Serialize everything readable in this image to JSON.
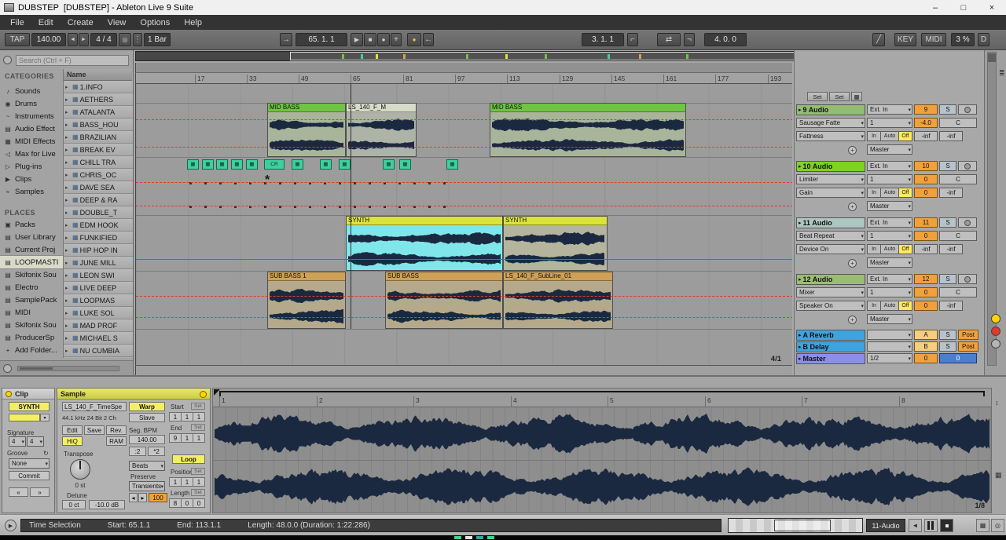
{
  "window": {
    "title": "DUBSTEP  [DUBSTEP] - Ableton Live 9 Suite"
  },
  "menu": {
    "items": [
      "File",
      "Edit",
      "Create",
      "View",
      "Options",
      "Help"
    ]
  },
  "transport": {
    "tap": "TAP",
    "tempo": "140.00",
    "sig": "4 / 4",
    "quantize": "1 Bar",
    "position": "65. 1. 1",
    "loop_start": "3. 1. 1",
    "loop_length": "4. 0. 0",
    "key": "KEY",
    "midi": "MIDI",
    "cpu": "3 %",
    "overload": "D"
  },
  "icons": {
    "app": "▦",
    "minimize": "–",
    "maximize": "□",
    "close": "×",
    "nudge_left": "◄",
    "nudge_right": "►",
    "metronome": "◎",
    "dots": "⋮",
    "follow": "→",
    "play": "▶",
    "stop": "■",
    "record": "●",
    "plus": "+",
    "back": "←",
    "punch_in": "⌐",
    "loop": "⇄",
    "punch_out": "¬",
    "pencil": "╱",
    "expander": "▸",
    "tri": "▸",
    "grid": "▦",
    "star": "*",
    "swap": "↻",
    "dropdown": "▾",
    "menu_lines": "≣",
    "updown": "↕",
    "speaker": "◄",
    "tri_left": "◂",
    "tri_right": "▸",
    "search": "◎"
  },
  "browser": {
    "search_placeholder": "Search (Ctrl + F)",
    "categories_label": "CATEGORIES",
    "places_label": "PLACES",
    "name_header": "Name",
    "categories": [
      {
        "icon": "♪",
        "label": "Sounds"
      },
      {
        "icon": "◉",
        "label": "Drums"
      },
      {
        "icon": "~",
        "label": "Instruments"
      },
      {
        "icon": "▤",
        "label": "Audio Effect"
      },
      {
        "icon": "▦",
        "label": "MIDI Effects"
      },
      {
        "icon": "◁",
        "label": "Max for Live"
      },
      {
        "icon": "▷",
        "label": "Plug-ins"
      },
      {
        "icon": "▶",
        "label": "Clips"
      },
      {
        "icon": "≈",
        "label": "Samples"
      }
    ],
    "places": [
      {
        "icon": "▣",
        "label": "Packs"
      },
      {
        "icon": "▤",
        "label": "User Library"
      },
      {
        "icon": "▤",
        "label": "Current Proj"
      },
      {
        "icon": "▤",
        "label": "LOOPMASTI"
      },
      {
        "icon": "▤",
        "label": "Skifonix Sou"
      },
      {
        "icon": "▤",
        "label": "Electro"
      },
      {
        "icon": "▤",
        "label": "SamplePack"
      },
      {
        "icon": "▤",
        "label": "MIDI"
      },
      {
        "icon": "▤",
        "label": "Skifonix Sou"
      },
      {
        "icon": "▤",
        "label": "ProducerSp"
      },
      {
        "icon": "+",
        "label": "Add Folder..."
      }
    ],
    "files": [
      "1.INFO",
      "AETHERS",
      "ATALANTA",
      "BASS_HOU",
      "BRAZILIAN",
      "BREAK EV",
      "CHILL TRA",
      "CHRIS_OC",
      "DAVE SEA",
      "DEEP & RA",
      "DOUBLE_T",
      "EDM HOOK",
      "FUNKIFIED",
      "HIP HOP IN",
      "JUNE MILL",
      "LEON SWI",
      "LIVE DEEP",
      "LOOPMAS",
      "LUKE SOL",
      "MAD PROF",
      "MICHAEL S",
      "NU CUMBIA"
    ]
  },
  "arrangement": {
    "ruler_ticks": [
      "17",
      "33",
      "49",
      "65",
      "81",
      "97",
      "113",
      "129",
      "145",
      "161",
      "177",
      "193"
    ],
    "set_label": "Set",
    "grid_value": "4/1",
    "clips": {
      "midbass1": "MID BASS",
      "ls140": "LS_140_F_M",
      "midbass2": "MID BASS",
      "crash": "CR",
      "synth1": "SYNTH",
      "synth2": "SYNTH",
      "subbass1": "SUB BASS 1",
      "subbass2": "SUB BASS",
      "subline": "LS_140_F_SubLine_01"
    }
  },
  "tracks": [
    {
      "name": "9 Audio",
      "input": "Ext. In",
      "num": "9",
      "solo": "S",
      "device1": "Sausage Fatte",
      "chain": "1",
      "val1": "-4.0",
      "pan": "C",
      "device2": "Fattness",
      "io": [
        "In",
        "Auto",
        "Off"
      ],
      "val2": "-inf",
      "val3": "-inf",
      "out": "Master"
    },
    {
      "name": "10 Audio",
      "input": "Ext. In",
      "num": "10",
      "solo": "S",
      "device1": "Limiter",
      "chain": "1",
      "val1": "0",
      "pan": "C",
      "device2": "Gain",
      "io": [
        "In",
        "Auto",
        "Off"
      ],
      "val2": "0",
      "val3": "-inf",
      "out": "Master"
    },
    {
      "name": "11 Audio",
      "input": "Ext. In",
      "num": "11",
      "solo": "S",
      "device1": "Beat Repeat",
      "chain": "1",
      "val1": "0",
      "pan": "C",
      "device2": "Device On",
      "io": [
        "In",
        "Auto",
        "Off"
      ],
      "val2": "-inf",
      "val3": "-inf",
      "out": "Master"
    },
    {
      "name": "12 Audio",
      "input": "Ext. In",
      "num": "12",
      "solo": "S",
      "device1": "Mixer",
      "chain": "1",
      "val1": "0",
      "pan": "C",
      "device2": "Speaker On",
      "io": [
        "In",
        "Auto",
        "Off"
      ],
      "val2": "0",
      "val3": "-inf",
      "out": "Master"
    }
  ],
  "returns": [
    {
      "name": "A Reverb",
      "letter": "A",
      "solo": "S",
      "mode": "Post"
    },
    {
      "name": "B Delay",
      "letter": "B",
      "solo": "S",
      "mode": "Post"
    }
  ],
  "master": {
    "name": "Master",
    "cue": "1/2",
    "val1": "0",
    "val2": "0"
  },
  "clip_panel": {
    "clip_header": "Clip",
    "sample_header": "Sample",
    "clip_name": "SYNTH",
    "signature_label": "Signature",
    "sig_num": "4",
    "sig_den": "4",
    "groove_label": "Groove",
    "groove_value": "None",
    "commit": "Commit",
    "nudge_back": "«",
    "nudge_fwd": "»",
    "sample_name": "LS_140_F_TimeSpe",
    "sample_info": "44.1 kHz 24 Bit 2 Ch",
    "edit": "Edit",
    "save": "Save",
    "rev": "Rev.",
    "hiq": "HiQ",
    "ram": "RAM",
    "transpose_label": "Transpose",
    "transpose_value": "0 st",
    "detune_label": "Detune",
    "detune_value": "0 ct",
    "gain_value": "-10.0 dB",
    "warp": "Warp",
    "slave": "Slave",
    "seg_bpm_label": "Seg. BPM",
    "seg_bpm": "140.00",
    "half": ":2",
    "double": "*2",
    "warp_mode": "Beats",
    "preserve_label": "Preserve",
    "transients": "Transients",
    "env_value": "100",
    "start_label": "Start",
    "set_label": "Set",
    "start": [
      "1",
      "1",
      "1"
    ],
    "end_label": "End",
    "end": [
      "9",
      "1",
      "1"
    ],
    "loop": "Loop",
    "position_label": "Position",
    "position": [
      "1",
      "1",
      "1"
    ],
    "length_label": "Length",
    "length": [
      "8",
      "0",
      "0"
    ]
  },
  "wave_panel": {
    "ruler": [
      "1",
      "2",
      "3",
      "4",
      "5",
      "6",
      "7",
      "8"
    ],
    "zoom_label": "1/8"
  },
  "status": {
    "mode": "Time Selection",
    "start": "Start: 65.1.1",
    "end": "End: 113.1.1",
    "length": "Length: 48.0.0  (Duration: 1:22:286)",
    "track": "11-Audio"
  }
}
